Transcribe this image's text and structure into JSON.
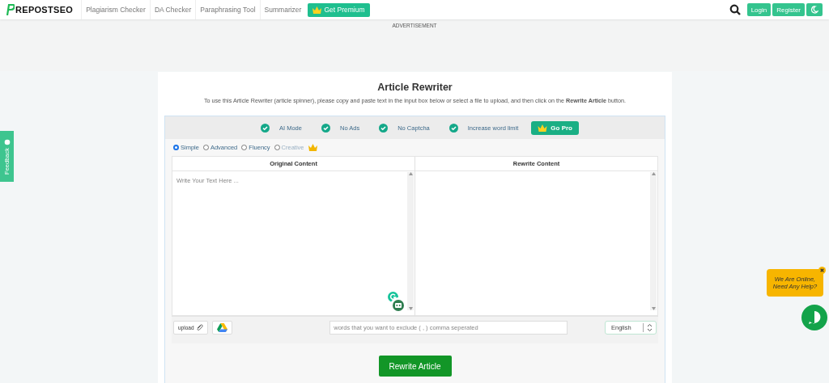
{
  "nav": {
    "logo": "REPOSTSEO",
    "links": [
      {
        "label": "Plagiarism Checker"
      },
      {
        "label": "DA Checker"
      },
      {
        "label": "Paraphrasing Tool"
      },
      {
        "label": "Summarizer"
      }
    ],
    "premium": "Get Premium",
    "login": "Login",
    "register": "Register"
  },
  "ad": {
    "label": "ADVERTISEMENT"
  },
  "feedback": "Feedback",
  "title": "Article Rewriter",
  "description": "To use this Article Rewriter (article spinner), please copy and paste text in the input box below or select a file to upload, and then click on the **Rewrite Article** button.",
  "features": [
    {
      "label": "AI Mode"
    },
    {
      "label": "No Ads"
    },
    {
      "label": "No Captcha"
    },
    {
      "label": "Increase word limit"
    }
  ],
  "go_pro": "Go Pro",
  "modes": [
    {
      "label": "Simple",
      "selected": true,
      "disabled": false,
      "premium": false
    },
    {
      "label": "Advanced",
      "selected": false,
      "disabled": false,
      "premium": false
    },
    {
      "label": "Fluency",
      "selected": false,
      "disabled": false,
      "premium": false
    },
    {
      "label": "Creative",
      "selected": false,
      "disabled": true,
      "premium": true
    }
  ],
  "columns": [
    {
      "header": "Original Content",
      "placeholder": "Write Your Text Here ..."
    },
    {
      "header": "Rewrite Content"
    }
  ],
  "upload": "upload",
  "exclude": {
    "placeholder": "words that you want to exclude ( , ) comma seperated"
  },
  "language": "English",
  "submit": "Rewrite Article",
  "chat": {
    "message": "We Are Online, Need Any Help?"
  }
}
